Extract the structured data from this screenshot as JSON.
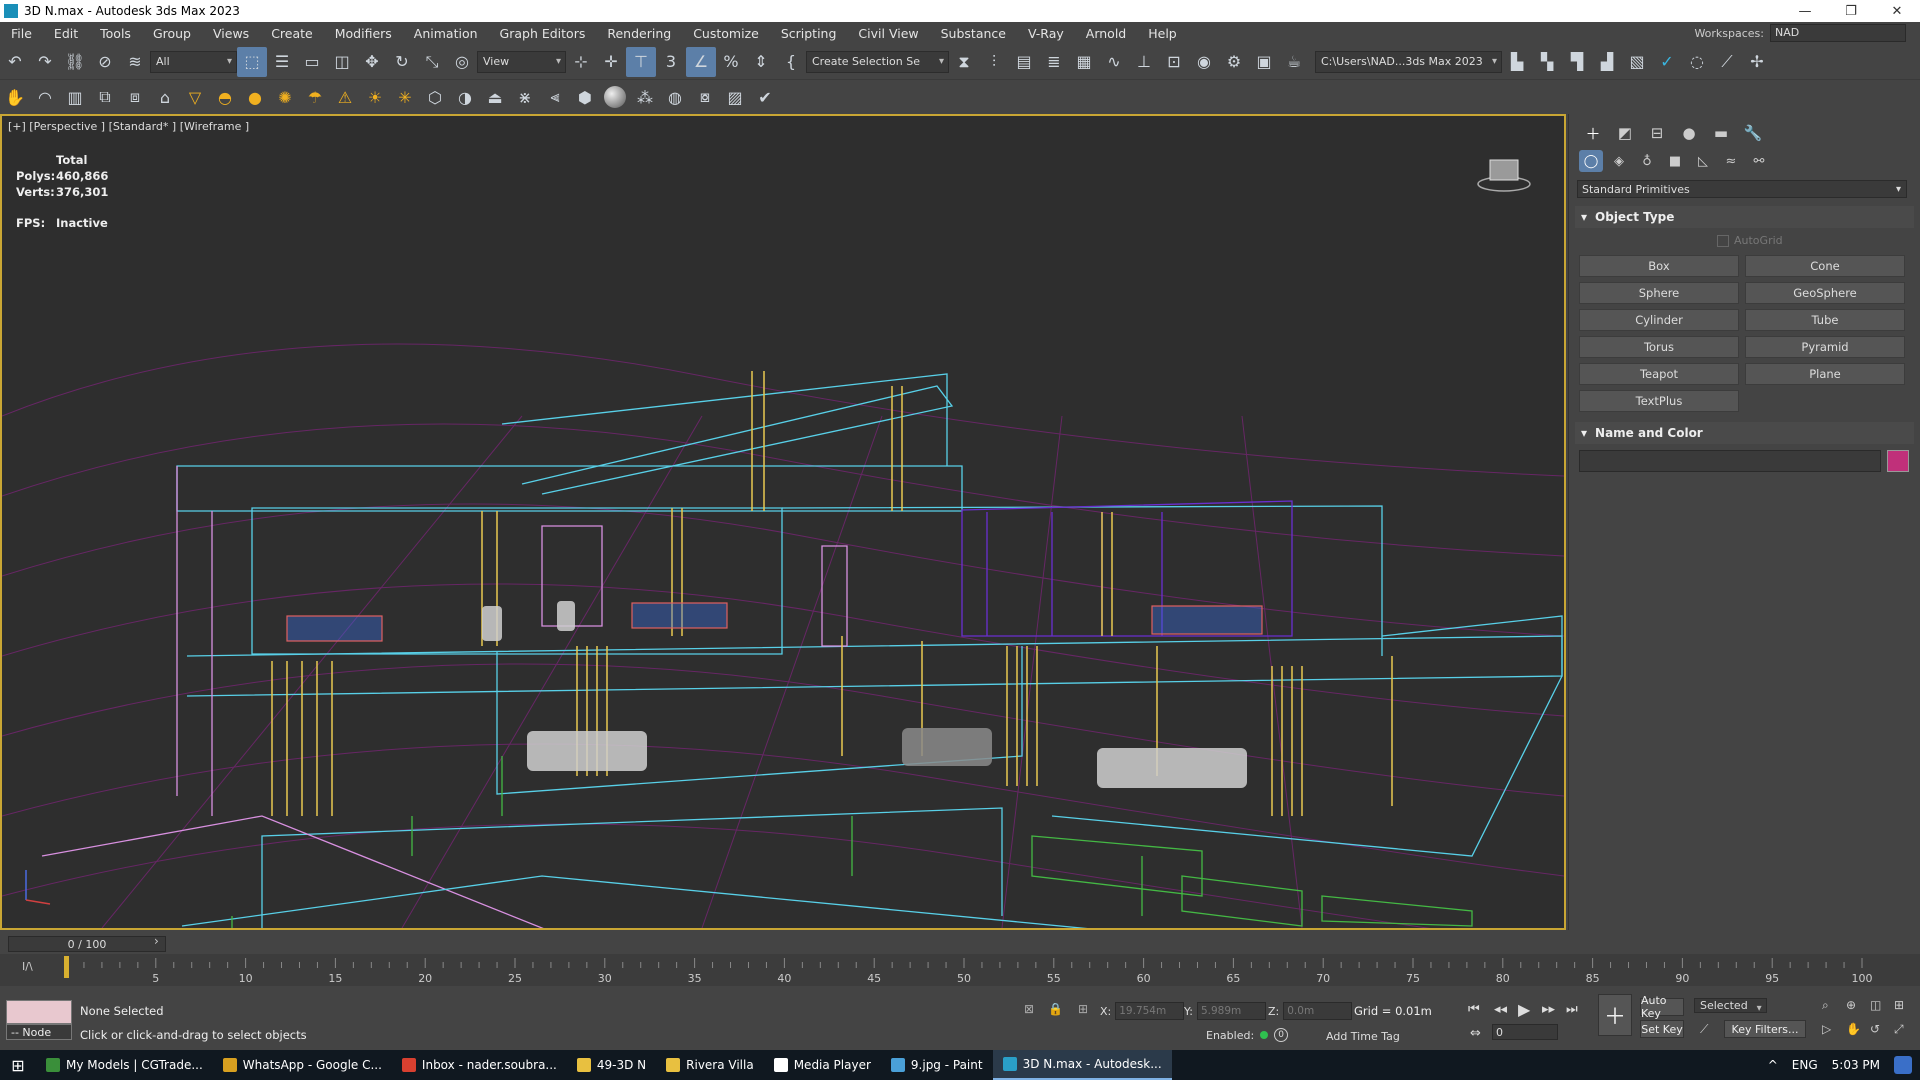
{
  "window": {
    "title": "3D N.max - Autodesk 3ds Max 2023"
  },
  "menu": [
    "File",
    "Edit",
    "Tools",
    "Group",
    "Views",
    "Create",
    "Modifiers",
    "Animation",
    "Graph Editors",
    "Rendering",
    "Customize",
    "Scripting",
    "Civil View",
    "Substance",
    "V-Ray",
    "Arnold",
    "Help"
  ],
  "workspaces": {
    "label": "Workspaces:",
    "value": "NAD"
  },
  "toolbar": {
    "filter_value": "All",
    "refcoord_value": "View",
    "selection_set_placeholder": "Create Selection Se",
    "project_path": "C:\\Users\\NAD...3ds Max 2023"
  },
  "viewport": {
    "label": "[+] [Perspective ] [Standard* ] [Wireframe ]",
    "stats_header": "Total",
    "polys_label": "Polys:",
    "polys_value": "460,866",
    "verts_label": "Verts:",
    "verts_value": "376,301",
    "fps_label": "FPS:",
    "fps_value": "Inactive",
    "colors": {
      "background": "#2e2e2e",
      "border": "#c9a634",
      "grid": "#8a2a8a"
    }
  },
  "command_panel": {
    "primitives_dropdown": "Standard Primitives",
    "object_type_title": "Object Type",
    "autogrid_label": "AutoGrid",
    "primitives": [
      "Box",
      "Cone",
      "Sphere",
      "GeoSphere",
      "Cylinder",
      "Tube",
      "Torus",
      "Pyramid",
      "Teapot",
      "Plane",
      "TextPlus"
    ],
    "name_color_title": "Name and Color",
    "object_color": "#c0307a"
  },
  "timeline": {
    "frame_display": "0 / 100",
    "ticks": [
      "5",
      "10",
      "15",
      "20",
      "25",
      "30",
      "35",
      "40",
      "45",
      "50",
      "55",
      "60",
      "65",
      "70",
      "75",
      "80",
      "85",
      "90",
      "95",
      "100"
    ],
    "toggle_label": "I/\\"
  },
  "status": {
    "node_label": "-- Node",
    "selection": "None Selected",
    "prompt": "Click or click-and-drag to select objects",
    "x_label": "X:",
    "x_value": "19.754m",
    "y_label": "Y:",
    "y_value": "5.989m",
    "z_label": "Z:",
    "z_value": "0.0m",
    "grid": "Grid = 0.01m",
    "enabled_label": "Enabled:",
    "enabled_value": "0",
    "add_time_tag": "Add Time Tag",
    "auto_key": "Auto Key",
    "set_key": "Set Key",
    "selected_dropdown": "Selected",
    "key_filters": "Key Filters...",
    "current_frame": "0"
  },
  "taskbar": {
    "items": [
      {
        "label": "My Models | CGTrade...",
        "color": "#3a8f3a"
      },
      {
        "label": "WhatsApp - Google C...",
        "color": "#d8a020"
      },
      {
        "label": "Inbox - nader.soubra...",
        "color": "#d84030"
      },
      {
        "label": "49-3D N",
        "color": "#e8c040"
      },
      {
        "label": "Rivera Villa",
        "color": "#e8c040"
      },
      {
        "label": "Media Player",
        "color": "#ffffff"
      },
      {
        "label": "9.jpg - Paint",
        "color": "#4aa0d8"
      },
      {
        "label": "3D N.max - Autodesk...",
        "color": "#2a9fc8"
      }
    ],
    "language": "ENG",
    "time": "5:03 PM"
  }
}
